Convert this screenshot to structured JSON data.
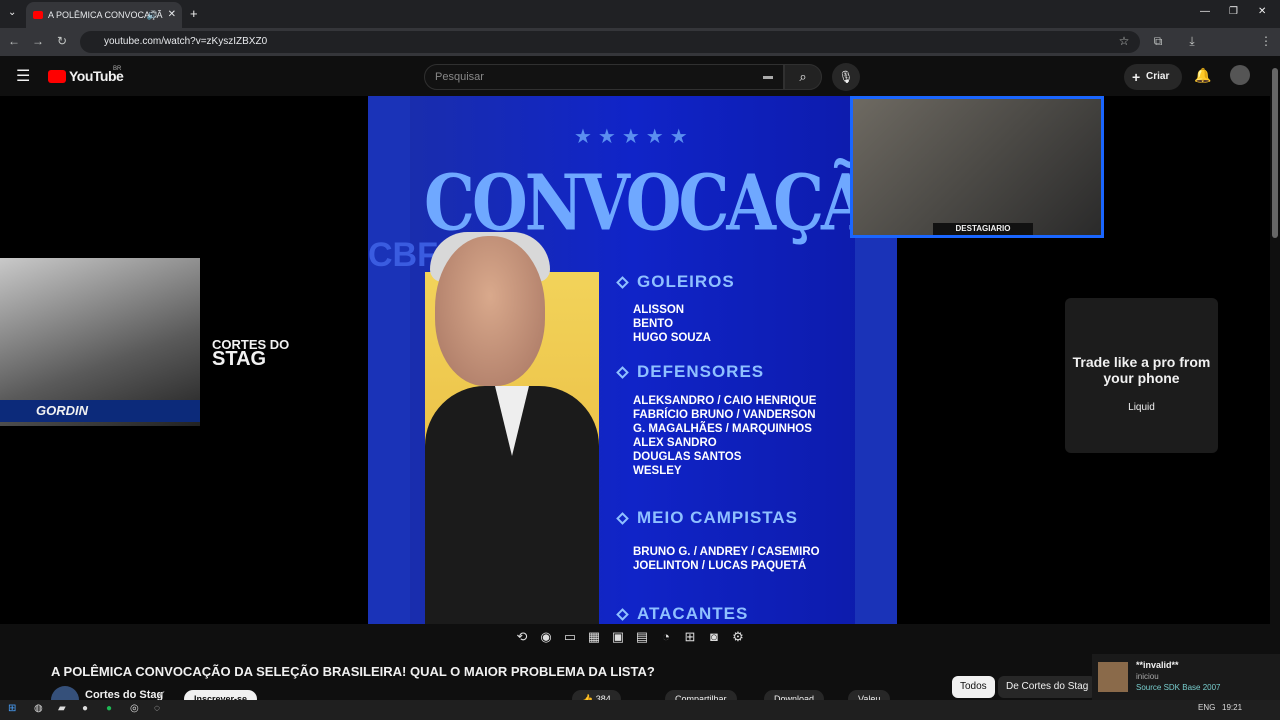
{
  "browser": {
    "tab_title": "A POLÊMICA CONVOCAÇÃ",
    "url": "youtube.com/watch?v=zKyszIZBXZ0"
  },
  "youtube": {
    "logo": "YouTube",
    "region": "BR",
    "search_placeholder": "Pesquisar",
    "create_label": "Criar"
  },
  "poster": {
    "title": "CONVOCAÇÃO",
    "side_text": "CBF",
    "sections": [
      {
        "heading": "GOLEIROS",
        "names": [
          "ALISSON",
          "BENTO",
          "HUGO SOUZA"
        ]
      },
      {
        "heading": "DEFENSORES",
        "names": [
          "ALEKSANDRO / CAIO HENRIQUE",
          "FABRÍCIO BRUNO / VANDERSON",
          "G. MAGALHÃES / MARQUINHOS",
          "ALEX SANDRO",
          "DOUGLAS SANTOS",
          "WESLEY"
        ]
      },
      {
        "heading": "MEIO CAMPISTAS",
        "names": [
          "BRUNO G. / ANDREY / CASEMIRO",
          "JOELINTON / LUCAS PAQUETÁ"
        ]
      },
      {
        "heading": "ATACANTES",
        "names": []
      }
    ]
  },
  "overlays": {
    "streamer_tag": "DESTAGIARIO",
    "gordin": "GORDIN",
    "stag_line1": "CORTES DO",
    "stag_line2": "STAG"
  },
  "ad": {
    "headline": "Trade like a pro from your phone",
    "brand": "Liquid"
  },
  "video": {
    "title": "A POLÊMICA CONVOCAÇÃO DA SELEÇÃO BRASILEIRA! QUAL O MAIOR PROBLEMA DA LISTA?",
    "channel": "Cortes do Stag",
    "subscribe": "Inscrever-se",
    "likes": "384",
    "share": "Compartilhar",
    "download": "Download",
    "thanks": "Valeu"
  },
  "chips": [
    "Todos",
    "De Cortes do Stag"
  ],
  "notification": {
    "name": "**invalid**",
    "action": "iniciou",
    "sub": "Source SDK Base 2007"
  },
  "taskbar": {
    "lang": "ENG",
    "time": "19:21"
  }
}
